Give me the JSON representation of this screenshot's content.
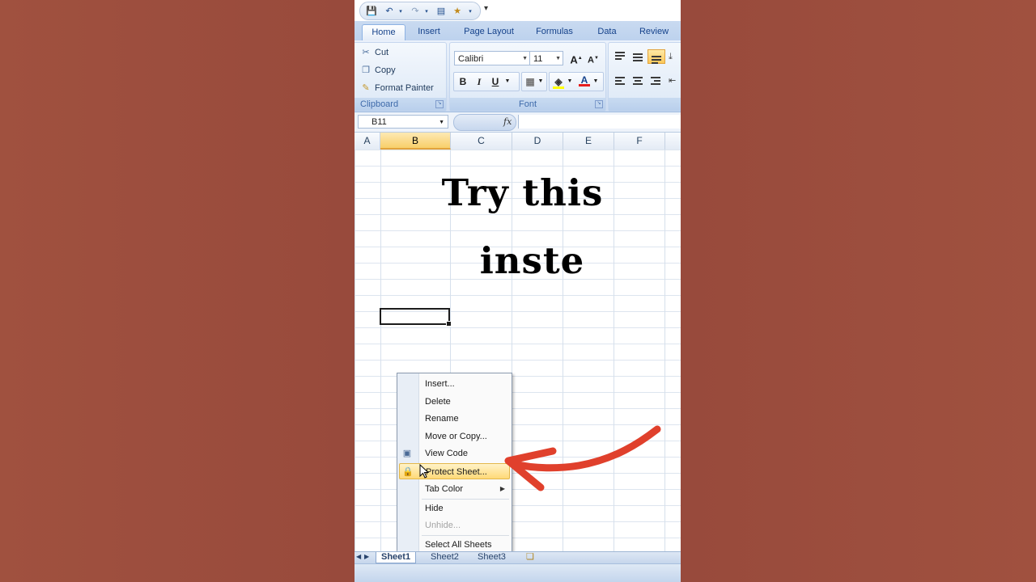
{
  "ribbon": {
    "tabs": [
      "Home",
      "Insert",
      "Page Layout",
      "Formulas",
      "Data",
      "Review"
    ],
    "clipboard": {
      "cut": "Cut",
      "copy": "Copy",
      "format_painter": "Format Painter",
      "label": "Clipboard"
    },
    "font": {
      "name": "Calibri",
      "size": "11",
      "bold": "B",
      "italic": "I",
      "underline": "U",
      "font_color": "A",
      "label": "Font"
    }
  },
  "formula_bar": {
    "name_box": "B11",
    "fx": "fx"
  },
  "columns": [
    "A",
    "B",
    "C",
    "D",
    "E",
    "F"
  ],
  "overlay": {
    "line1": "Try this",
    "line2": "inste"
  },
  "context_menu": {
    "items": [
      {
        "label": "Insert...",
        "enabled": true
      },
      {
        "label": "Delete",
        "enabled": true
      },
      {
        "label": "Rename",
        "enabled": true
      },
      {
        "label": "Move or Copy...",
        "enabled": true
      },
      {
        "label": "View Code",
        "enabled": true
      },
      {
        "label": "Protect Sheet...",
        "enabled": true,
        "highlighted": true
      },
      {
        "label": "Tab Color",
        "enabled": true
      },
      {
        "label": "Hide",
        "enabled": true
      },
      {
        "label": "Unhide...",
        "enabled": false
      },
      {
        "label": "Select All Sheets",
        "enabled": true
      }
    ]
  },
  "sheet_tabs": [
    "Sheet1",
    "Sheet2",
    "Sheet3"
  ],
  "colors": {
    "background": "#9b4f40",
    "annotation_arrow": "#e0402c",
    "ribbon_text": "#15428b",
    "highlight": "#ffd978"
  }
}
